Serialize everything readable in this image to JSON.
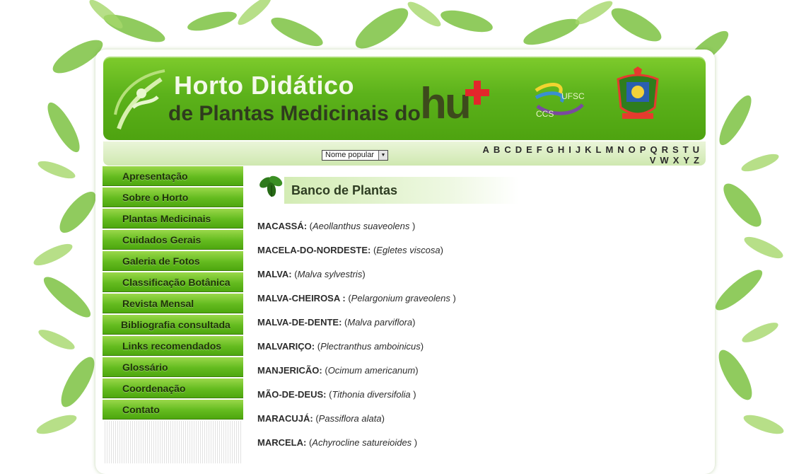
{
  "header": {
    "title_line1": "Horto Didático",
    "title_line2": "de Plantas Medicinais do",
    "logo_text": "hu",
    "ufsc_label": "UFSC",
    "ccs_label": "CCS"
  },
  "alpha_nav": {
    "select_value": "Nome popular",
    "letters": [
      "A",
      "B",
      "C",
      "D",
      "E",
      "F",
      "G",
      "H",
      "I",
      "J",
      "K",
      "L",
      "M",
      "N",
      "O",
      "P",
      "Q",
      "R",
      "S",
      "T",
      "U",
      "V",
      "W",
      "X",
      "Y",
      "Z"
    ]
  },
  "sidebar": {
    "items": [
      {
        "label": "Apresentação"
      },
      {
        "label": "Sobre o Horto"
      },
      {
        "label": "Plantas Medicinais"
      },
      {
        "label": "Cuidados Gerais"
      },
      {
        "label": "Galeria de Fotos"
      },
      {
        "label": "Classificação Botânica"
      },
      {
        "label": "Revista Mensal"
      },
      {
        "label": "Bibliografia consultada"
      },
      {
        "label": "Links recomendados"
      },
      {
        "label": "Glossário"
      },
      {
        "label": "Coordenação"
      },
      {
        "label": "Contato"
      }
    ]
  },
  "main": {
    "section_title": "Banco de Plantas",
    "plants": [
      {
        "name": "MACASSÁ:",
        "open": " (",
        "scientific": "Aeollanthus suaveolens",
        "close": " )"
      },
      {
        "name": "MACELA-DO-NORDESTE:",
        "open": " (",
        "scientific": "Egletes viscosa",
        "close": ")"
      },
      {
        "name": "MALVA:",
        "open": " (",
        "scientific": "Malva sylvestris",
        "close": ")"
      },
      {
        "name": "MALVA-CHEIROSA :",
        "open": " (",
        "scientific": "Pelargonium graveolens",
        "close": " )"
      },
      {
        "name": "MALVA-DE-DENTE:",
        "open": " (",
        "scientific": "Malva parviflora",
        "close": ")"
      },
      {
        "name": "MALVARIÇO:",
        "open": " (",
        "scientific": "Plectranthus amboinicus",
        "close": ")"
      },
      {
        "name": "MANJERICÃO:",
        "open": " (",
        "scientific": "Ocimum americanum",
        "close": ")"
      },
      {
        "name": "MÃO-DE-DEUS:",
        "open": " (",
        "scientific": "Tithonia diversifolia",
        "close": " )"
      },
      {
        "name": "MARACUJÁ:",
        "open": " (",
        "scientific": "Passiflora alata",
        "close": ")"
      },
      {
        "name": "MARCELA:",
        "open": " (",
        "scientific": "Achyrocline satureioides",
        "close": " )"
      }
    ]
  },
  "colors": {
    "banner_green": "#5cb21b",
    "menu_green": "#64bb1f",
    "cross_red": "#e3262b",
    "text_dark": "#2c2c2c"
  }
}
